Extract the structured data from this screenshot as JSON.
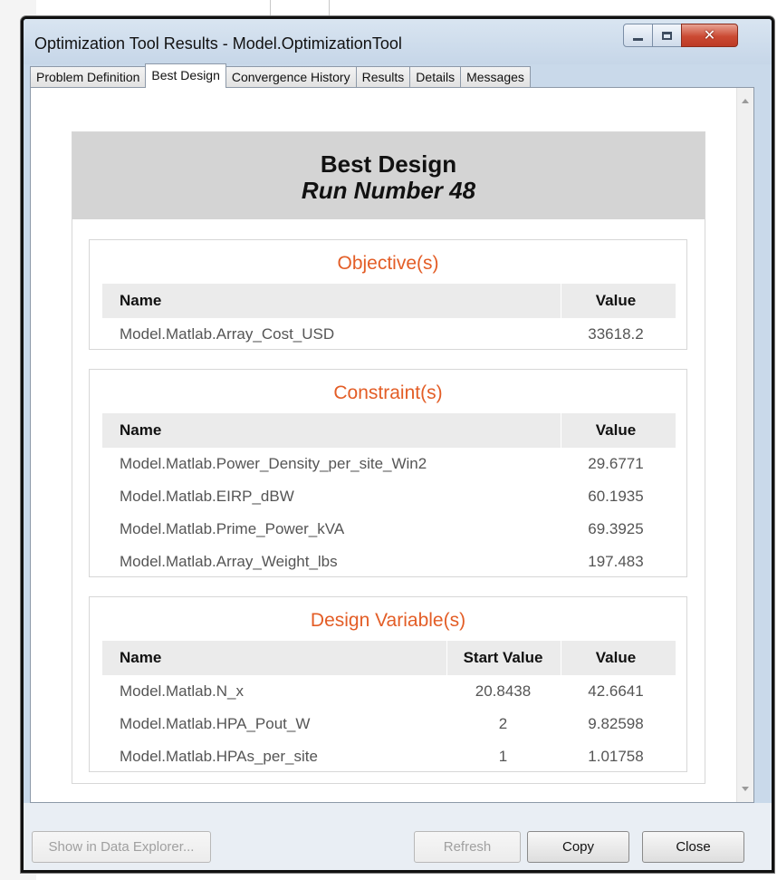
{
  "window": {
    "title": "Optimization Tool Results - Model.OptimizationTool"
  },
  "tabs": [
    {
      "label": "Problem Definition",
      "active": false
    },
    {
      "label": "Best Design",
      "active": true
    },
    {
      "label": "Convergence History",
      "active": false
    },
    {
      "label": "Results",
      "active": false
    },
    {
      "label": "Details",
      "active": false
    },
    {
      "label": "Messages",
      "active": false
    }
  ],
  "header": {
    "title": "Best Design",
    "subtitle": "Run Number 48"
  },
  "objectives": {
    "title": "Objective(s)",
    "columns": {
      "name": "Name",
      "value": "Value"
    },
    "rows": [
      {
        "name": "Model.Matlab.Array_Cost_USD",
        "value": "33618.2"
      }
    ]
  },
  "constraints": {
    "title": "Constraint(s)",
    "columns": {
      "name": "Name",
      "value": "Value"
    },
    "rows": [
      {
        "name": "Model.Matlab.Power_Density_per_site_Win2",
        "value": "29.6771"
      },
      {
        "name": "Model.Matlab.EIRP_dBW",
        "value": "60.1935"
      },
      {
        "name": "Model.Matlab.Prime_Power_kVA",
        "value": "69.3925"
      },
      {
        "name": "Model.Matlab.Array_Weight_lbs",
        "value": "197.483"
      }
    ]
  },
  "design_variables": {
    "title": "Design Variable(s)",
    "columns": {
      "name": "Name",
      "start": "Start Value",
      "value": "Value"
    },
    "rows": [
      {
        "name": "Model.Matlab.N_x",
        "start": "20.8438",
        "value": "42.6641"
      },
      {
        "name": "Model.Matlab.HPA_Pout_W",
        "start": "2",
        "value": "9.82598"
      },
      {
        "name": "Model.Matlab.HPAs_per_site",
        "start": "1",
        "value": "1.01758"
      }
    ]
  },
  "buttons": {
    "show_in_data_explorer": "Show in Data Explorer...",
    "refresh": "Refresh",
    "copy": "Copy",
    "close": "Close"
  },
  "colors": {
    "section_title": "#e35d26",
    "header_background": "#d4d4d4",
    "close_button": "#cb4a33"
  }
}
